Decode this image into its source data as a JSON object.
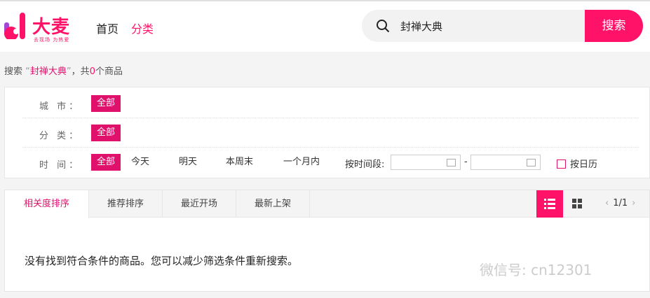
{
  "brand": {
    "name": "大麦",
    "slogan": "去现场 为热爱",
    "color": "#ff1268"
  },
  "nav": {
    "home": "首页",
    "category": "分类"
  },
  "search": {
    "value": "封禅大典",
    "button": "搜索"
  },
  "summary": {
    "prefix": "搜索",
    "open_quote": "“",
    "keyword": "封禅大典",
    "close_quote": "”",
    "mid": "，共",
    "count": "0",
    "suffix": "个商品"
  },
  "filters": {
    "city": {
      "label": "城  市：",
      "options": [
        "全部"
      ]
    },
    "category": {
      "label": "分  类：",
      "options": [
        "全部"
      ]
    },
    "time": {
      "label": "时  间：",
      "options": [
        "全部",
        "今天",
        "明天",
        "本周末",
        "一个月内"
      ],
      "range_label": "按时间段:",
      "range_sep": "-",
      "calendar": "按日历"
    }
  },
  "sort_tabs": [
    "相关度排序",
    "推荐排序",
    "最近开场",
    "最新上架"
  ],
  "pager": {
    "prev": "‹",
    "text": "1/1",
    "next": "›"
  },
  "empty_message": "没有找到符合条件的商品。您可以减少筛选条件重新搜索。",
  "watermark": "微信号: cn12301"
}
